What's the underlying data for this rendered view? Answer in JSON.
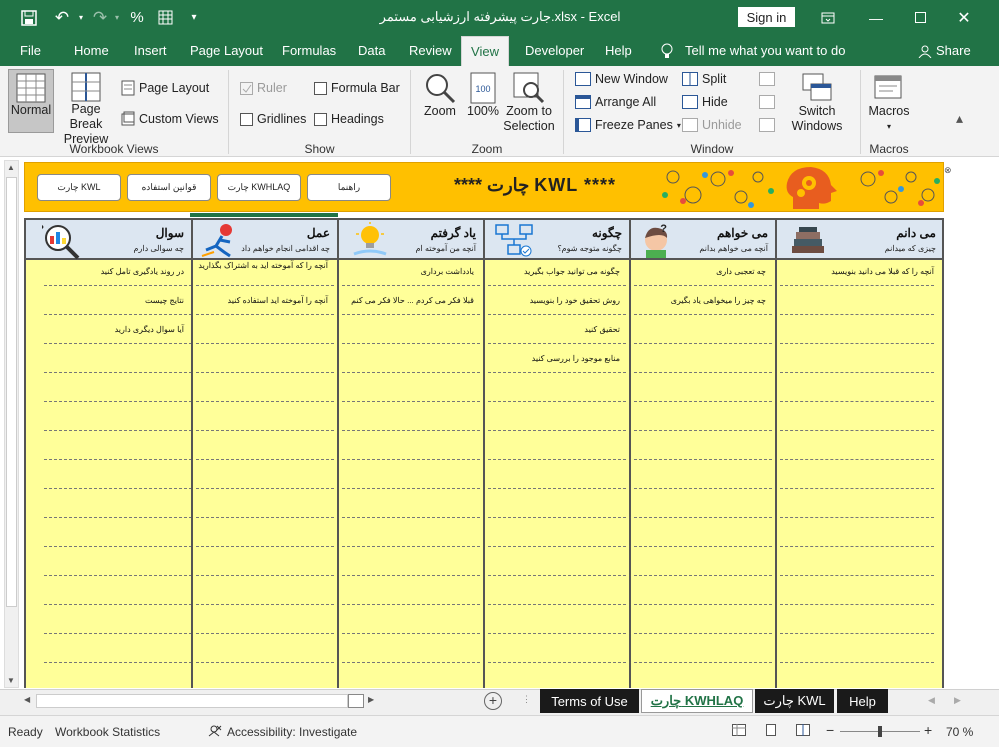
{
  "window": {
    "title": "جارت پیشرفته ارزشیابی مستمر.xlsx  -  Excel",
    "signin": "Sign in"
  },
  "qat": {
    "percent_icon": "%"
  },
  "tabs": [
    "File",
    "Home",
    "Insert",
    "Page Layout",
    "Formulas",
    "Data",
    "Review",
    "View",
    "Developer",
    "Help"
  ],
  "tell_me": "Tell me what you want to do",
  "share": "Share",
  "ribbon": {
    "workbook_views": {
      "label": "Workbook Views",
      "normal": "Normal",
      "page_break": "Page Break Preview",
      "page_layout": "Page Layout",
      "custom_views": "Custom Views"
    },
    "show": {
      "label": "Show",
      "ruler": "Ruler",
      "gridlines": "Gridlines",
      "formula_bar": "Formula Bar",
      "headings": "Headings"
    },
    "zoom": {
      "label": "Zoom",
      "zoom": "Zoom",
      "hundred": "100%",
      "zoom_selection": "Zoom to Selection"
    },
    "window": {
      "label": "Window",
      "new_window": "New Window",
      "arrange_all": "Arrange All",
      "freeze_panes": "Freeze Panes",
      "split": "Split",
      "hide": "Hide",
      "unhide": "Unhide",
      "switch_windows": "Switch Windows"
    },
    "macros": {
      "label": "Macros",
      "macros": "Macros"
    }
  },
  "sheet": {
    "nav_buttons": [
      "چارت KWL",
      "قوانین استفاده",
      "چارت KWHLAQ",
      "راهنما"
    ],
    "banner_title": "**** چارت KWL ****",
    "columns": [
      {
        "title": "می دانم",
        "subtitle": "چیزی که میدانم"
      },
      {
        "title": "می خواهم",
        "subtitle": "آنچه می خواهم بدانم"
      },
      {
        "title": "چگونه",
        "subtitle": "چگونه متوجه شوم؟"
      },
      {
        "title": "یاد گرفتم",
        "subtitle": "آنچه من آموخته ام"
      },
      {
        "title": "عمل",
        "subtitle": "چه اقدامی انجام خواهم داد"
      },
      {
        "title": "سوال",
        "subtitle": "چه سوالی دارم"
      }
    ],
    "cells": {
      "c1": [
        "آنچه را که قبلا می دانید بنویسید"
      ],
      "c2": [
        "چه تعجبی داری",
        "چه چیز را میخواهی یاد بگیری"
      ],
      "c3": [
        "چگونه می توانید جواب بگیرید",
        "روش تحقیق خود را بنویسید",
        "تحقیق کنید",
        "منابع موجود را بررسی کنید"
      ],
      "c4": [
        "یادداشت برداری",
        "قبلا فکر می کردم ... حالا فکر می کنم"
      ],
      "c5": [
        "آنچه را که آموخته اید به اشتراک بگذارید",
        "آنچه را آموخته اید استفاده کنید"
      ],
      "c6": [
        "در روند یادگیری تامل کنید",
        "نتایج چیست",
        "آیا سوال دیگری دارید"
      ]
    }
  },
  "sheet_tabs": [
    "Terms of Use",
    "چارت KWHLAQ",
    "چارت KWL",
    "Help"
  ],
  "status": {
    "ready": "Ready",
    "stats": "Workbook Statistics",
    "accessibility": "Accessibility: Investigate",
    "zoom": "70 %"
  }
}
